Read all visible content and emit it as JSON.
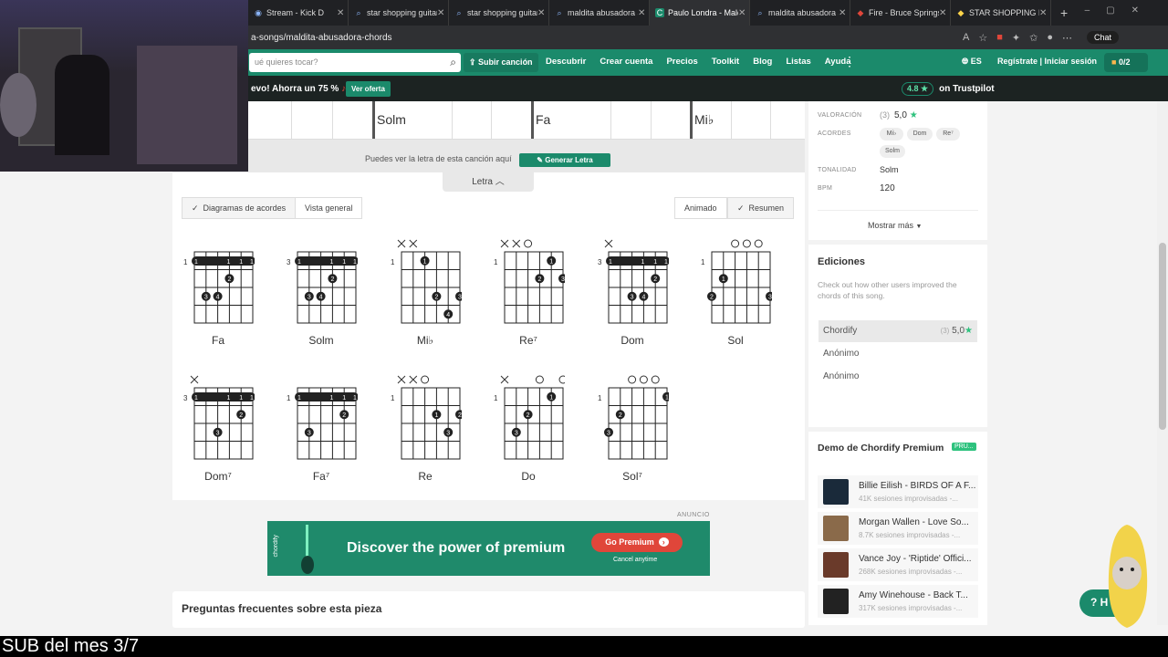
{
  "browser": {
    "tabs": [
      {
        "label": "Stream - Kick D",
        "active": false
      },
      {
        "label": "star shopping guitar",
        "active": false
      },
      {
        "label": "star shopping guitar",
        "active": false
      },
      {
        "label": "maldita abusadora a",
        "active": false
      },
      {
        "label": "Paulo Londra - Mald",
        "active": true
      },
      {
        "label": "maldita abusadora a",
        "active": false
      },
      {
        "label": "Fire - Bruce Springs",
        "active": false
      },
      {
        "label": "STAR SHOPPING IN",
        "active": false
      }
    ],
    "url": "a-songs/maldita-abusadora-chords",
    "chat_label": "Chat"
  },
  "header": {
    "search_placeholder": "ué quieres tocar?",
    "upload_label": "Subir canción",
    "nav": [
      "Descubrir",
      "Crear cuenta",
      "Precios",
      "Toolkit",
      "Blog",
      "Listas",
      "Ayuda"
    ],
    "lang": "ES",
    "register": "Regístrate | Iniciar sesión",
    "counter": "0/2"
  },
  "promo": {
    "text": "evo! Ahorra un 75 %",
    "button": "Ver oferta",
    "rating_score": "4.8 ★",
    "rating_text": "on Trustpilot"
  },
  "strip": {
    "chords": [
      "Solm",
      "Fa",
      "Mi♭"
    ]
  },
  "lyrics_bar": {
    "text": "Puedes ver la letra de esta canción aquí",
    "button": "Generar Letra",
    "tab": "Letra"
  },
  "view_toggles": {
    "diagrams": "Diagramas de acordes",
    "overview": "Vista general",
    "animated": "Animado",
    "summary": "Resumen"
  },
  "chords": [
    {
      "name": "Fa",
      "fret": "1"
    },
    {
      "name": "Solm",
      "fret": "3"
    },
    {
      "name": "Mi♭",
      "fret": "1"
    },
    {
      "name": "Re⁷",
      "fret": "1"
    },
    {
      "name": "Dom",
      "fret": "3"
    },
    {
      "name": "Sol",
      "fret": "1"
    },
    {
      "name": "Dom⁷",
      "fret": "3"
    },
    {
      "name": "Fa⁷",
      "fret": "1"
    },
    {
      "name": "Re",
      "fret": "1"
    },
    {
      "name": "Do",
      "fret": "1"
    },
    {
      "name": "Sol⁷",
      "fret": "1"
    }
  ],
  "ad": {
    "label": "ANUNCIO",
    "brand": "chordify",
    "headline": "Discover the power of premium",
    "button": "Go Premium",
    "cancel": "Cancel anytime"
  },
  "faq": {
    "title": "Preguntas frecuentes sobre esta pieza"
  },
  "info": {
    "rating_key": "VALORACIÓN",
    "rating_count": "(3)",
    "rating_value": "5,0",
    "chords_key": "ACORDES",
    "chord_chips": [
      "Mi♭",
      "Dom",
      "Re⁷",
      "Solm"
    ],
    "key_key": "TONALIDAD",
    "key_value": "Solm",
    "bpm_key": "BPM",
    "bpm_value": "120",
    "more": "Mostrar más"
  },
  "editions": {
    "title": "Ediciones",
    "desc": "Check out how other users improved the chords of this song.",
    "rows": [
      {
        "name": "Chordify",
        "count": "(3)",
        "rating": "5,0"
      },
      {
        "name": "Anónimo"
      },
      {
        "name": "Anónimo"
      }
    ]
  },
  "demo": {
    "title": "Demo de Chordify Premium",
    "badge": "PRU...",
    "songs": [
      {
        "title": "Billie Eilish - BIRDS OF A F...",
        "sub": "41K sesiones improvisadas -..."
      },
      {
        "title": "Morgan Wallen - Love So...",
        "sub": "8.7K sesiones improvisadas -..."
      },
      {
        "title": "Vance Joy - 'Riptide' Offici...",
        "sub": "268K sesiones improvisadas -..."
      },
      {
        "title": "Amy Winehouse - Back T...",
        "sub": "317K sesiones improvisadas -..."
      }
    ]
  },
  "overlay": {
    "caption": "SUB del mes 3/7",
    "help": "? H"
  },
  "colors": {
    "brand": "#1b8a6b",
    "accent_red": "#e0463a",
    "star": "#2ec27e"
  }
}
